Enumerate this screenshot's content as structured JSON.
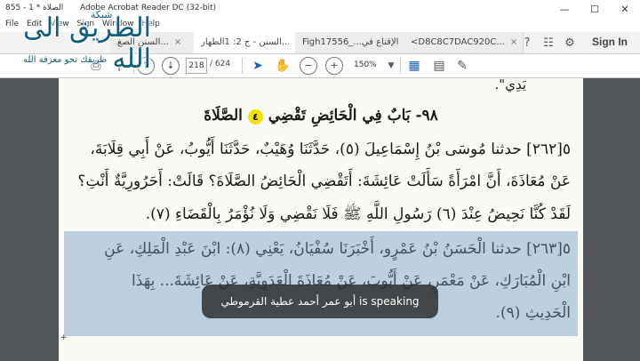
{
  "window": {
    "doc_title": "855 - 1 * الصلاة",
    "app_title": "Adobe Acrobat Reader DC (32-bit)",
    "minimize": "—",
    "maximize": "☐",
    "close": "✕"
  },
  "menu": [
    "File",
    "Edit",
    "View",
    "Sign",
    "Window",
    "Help"
  ],
  "tabs": [
    {
      "label": "السنن الصغ...",
      "close": "×"
    },
    {
      "label": "السنن - ج 2: 1الطهار...",
      "close": "×"
    },
    {
      "label": "Figh17556_...الإقناع في",
      "close": "×"
    },
    {
      "label": "<D8C8C7DAC920C...",
      "close": "×"
    }
  ],
  "topbar_icons": [
    "help-icon",
    "notifications-icon",
    "sign-in"
  ],
  "signin_label": "Sign In",
  "toolbar": {
    "page_current": "218",
    "page_total": "/ 624",
    "zoom": "150%"
  },
  "logo": {
    "main": "الطريق الى الله",
    "top": "شبكة",
    "tagline": "طريقك نحو معرفة الله",
    "url": "WAY2ALLAH.COM"
  },
  "document": {
    "top_fragment": "يَدِي\".",
    "heading": "٩٨- بَابٌ فِي الْحَائِضِ تَقْضِي",
    "heading_note": "(٤)",
    "heading_end": "الصَّلَاةَ",
    "lines": [
      "٥[٢٦٢] حدثنا مُوسَى بْنُ إِسْمَاعِيلَ (٥)، حَدَّثَنَا وُهَيْبٌ، حَدَّثَنَا أَيُّوبُ، عَنْ أَبِي قِلَابَةَ،",
      "عَنْ مُعَاذَةَ، أَنَّ امْرَأَةً سَأَلَتْ عَائِشَةَ: أَتَقْضِي الْحَائِضُ الصَّلَاةَ؟ قَالَتْ: أَحَرُورِيَّةٌ أَنْتِ؟",
      "لَقَدْ كُنَّا نَحِيضُ عِنْدَ (٦) رَسُولِ اللَّهِ ﷺ فَلَا نَقْضِي وَلَا نُؤْمَرُ بِالْقَضَاءِ (٧)."
    ],
    "highlight_lines": [
      "٥[٢٦٣] حدثنا الْحَسَنُ بْنُ عَمْرٍو، أَخْبَرَنَا سُفْيَانُ، يَعْنِي (٨): ابْنَ عَبْدِ الْمَلِكِ، عَنِ",
      "ابْنِ الْمُبَارَكِ، عَنْ مَعْمَرٍ، عَنْ أَيُّوبَ، عَنْ مُعَاذَةَ الْعَدَوِيَّةِ، عَنْ عَائِشَةَ... بِهَذَا",
      "الْحَدِيثِ (٩)."
    ]
  },
  "caption": {
    "name": "أبو عمر أحمد عطية القرموطي",
    "status": "is speaking"
  }
}
